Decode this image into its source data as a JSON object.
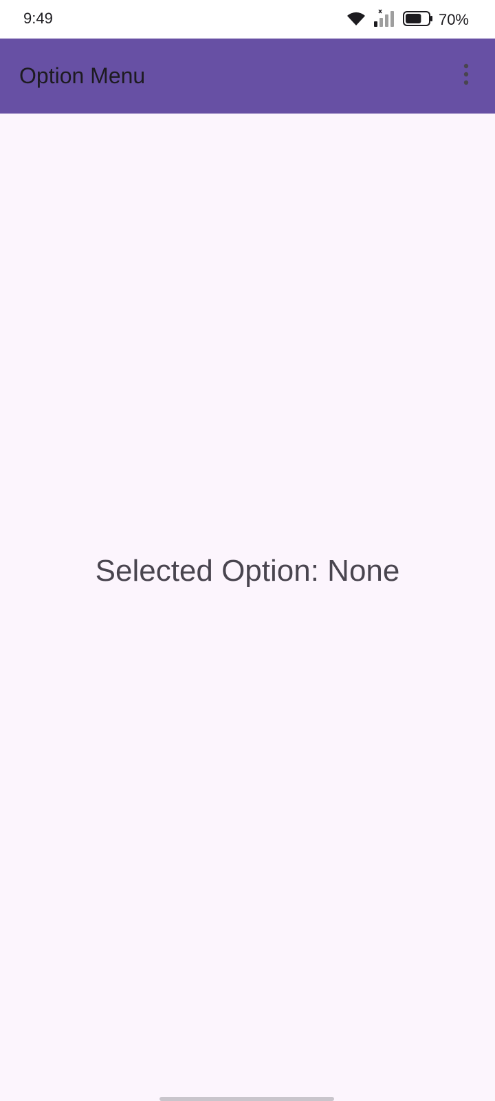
{
  "status_bar": {
    "time": "9:49",
    "battery_percent": "70%",
    "battery_level": 0.7,
    "icons": [
      "wifi-icon",
      "signal-icon",
      "battery-icon"
    ]
  },
  "app_bar": {
    "title": "Option Menu",
    "overflow_icon": "more-vert-icon",
    "background_color": "#6750a4"
  },
  "main": {
    "selected_option_text": "Selected Option: None"
  },
  "colors": {
    "background": "#fcf5fd",
    "primary": "#6750a4",
    "on_surface_variant": "#49454f"
  }
}
